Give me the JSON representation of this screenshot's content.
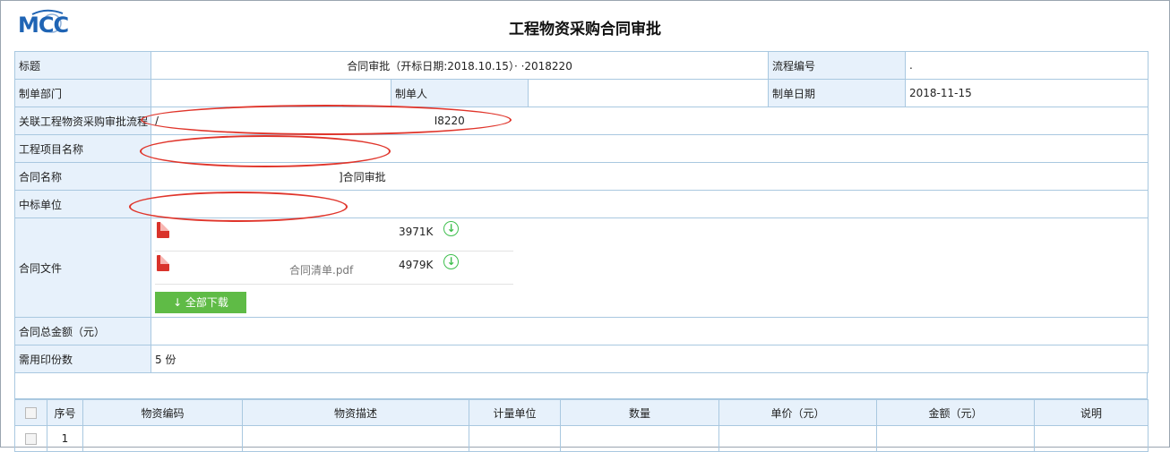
{
  "header": {
    "logo_text": "MCC",
    "title": "工程物资采购合同审批"
  },
  "form": {
    "title_label": "标题",
    "title_value": "合同审批（开标日期:2018.10.15）·        ·2018220",
    "flow_no_label": "流程编号",
    "flow_no_value": ".",
    "dept_label": "制单部门",
    "dept_value": "",
    "maker_label": "制单人",
    "maker_value": "",
    "date_label": "制单日期",
    "date_value": "2018-11-15",
    "related_label": "关联工程物资采购审批流程",
    "related_value_prefix": "/",
    "related_value": "I8220",
    "project_label": "工程项目名称",
    "project_value": "",
    "contract_name_label": "合同名称",
    "contract_name_value": "]合同审批",
    "winner_label": "中标单位",
    "winner_value": "",
    "files_label": "合同文件",
    "files": [
      {
        "name": "",
        "size": "3971K",
        "icon": "pdf-icon"
      },
      {
        "name": "合同清单.pdf",
        "size": "4979K",
        "icon": "pdf-icon"
      }
    ],
    "download_all_label": "↓  全部下载",
    "amount_label": "合同总金额（元）",
    "amount_value": "",
    "seal_label": "需用印份数",
    "seal_value": "5 份"
  },
  "grid": {
    "columns": [
      "序号",
      "物资编码",
      "物资描述",
      "计量单位",
      "数量",
      "单价（元）",
      "金额（元）",
      "说明"
    ],
    "rows": [
      {
        "index": "1"
      }
    ]
  },
  "colors": {
    "label_bg": "#e7f1fb",
    "border": "#a9c8e0",
    "download_green": "#5fbb46",
    "annotation_red": "#e0352b",
    "logo_blue": "#1f64b4"
  }
}
